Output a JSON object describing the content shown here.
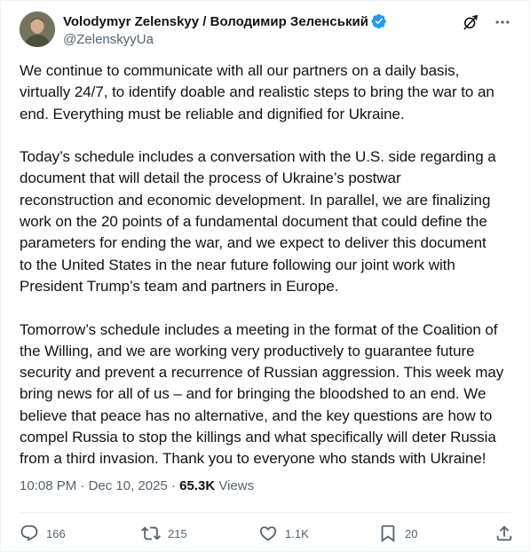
{
  "author": {
    "display_name": "Volodymyr Zelenskyy / Володимир Зеленський",
    "handle": "@ZelenskyyUa",
    "verified": true
  },
  "body": {
    "paragraphs": [
      "We continue to communicate with all our partners on a daily basis,\nvirtually 24/7, to identify doable and realistic steps to bring the war to an\nend. Everything must be reliable and dignified for Ukraine.",
      "Today’s schedule includes a conversation with the U.S. side regarding a\ndocument that will detail the process of Ukraine’s postwar\nreconstruction and economic development. In parallel, we are finalizing\nwork on the 20 points of a fundamental document that could define the\nparameters for ending the war, and we expect to deliver this document\nto the United States in the near future following our joint work with\nPresident Trump’s team and partners in Europe.",
      "Tomorrow’s schedule includes a meeting in the format of the Coalition of\nthe Willing, and we are working very productively to guarantee future\nsecurity and prevent a recurrence of Russian aggression. This week may\nbring news for all of us – and for bringing the bloodshed to an end. We\nbelieve that peace has no alternative, and the key questions are how to\ncompel Russia to stop the killings and what specifically will deter Russia\nfrom a third invasion. Thank you to everyone who stands with Ukraine!"
    ]
  },
  "meta": {
    "time": "10:08 PM",
    "separator": " · ",
    "date": "Dec 10, 2025",
    "views_count": "65.3K",
    "views_label": "Views"
  },
  "actions": {
    "replies": "166",
    "reposts": "215",
    "likes": "1.1K",
    "bookmarks": "20"
  },
  "colors": {
    "text": "#0f1419",
    "secondary": "#536471",
    "verified": "#1d9bf0",
    "divider": "#eff3f4"
  },
  "icons": {
    "top": [
      "grok-icon",
      "more-icon"
    ],
    "actions": [
      "reply-icon",
      "repost-icon",
      "like-icon",
      "bookmark-icon",
      "share-icon"
    ]
  }
}
